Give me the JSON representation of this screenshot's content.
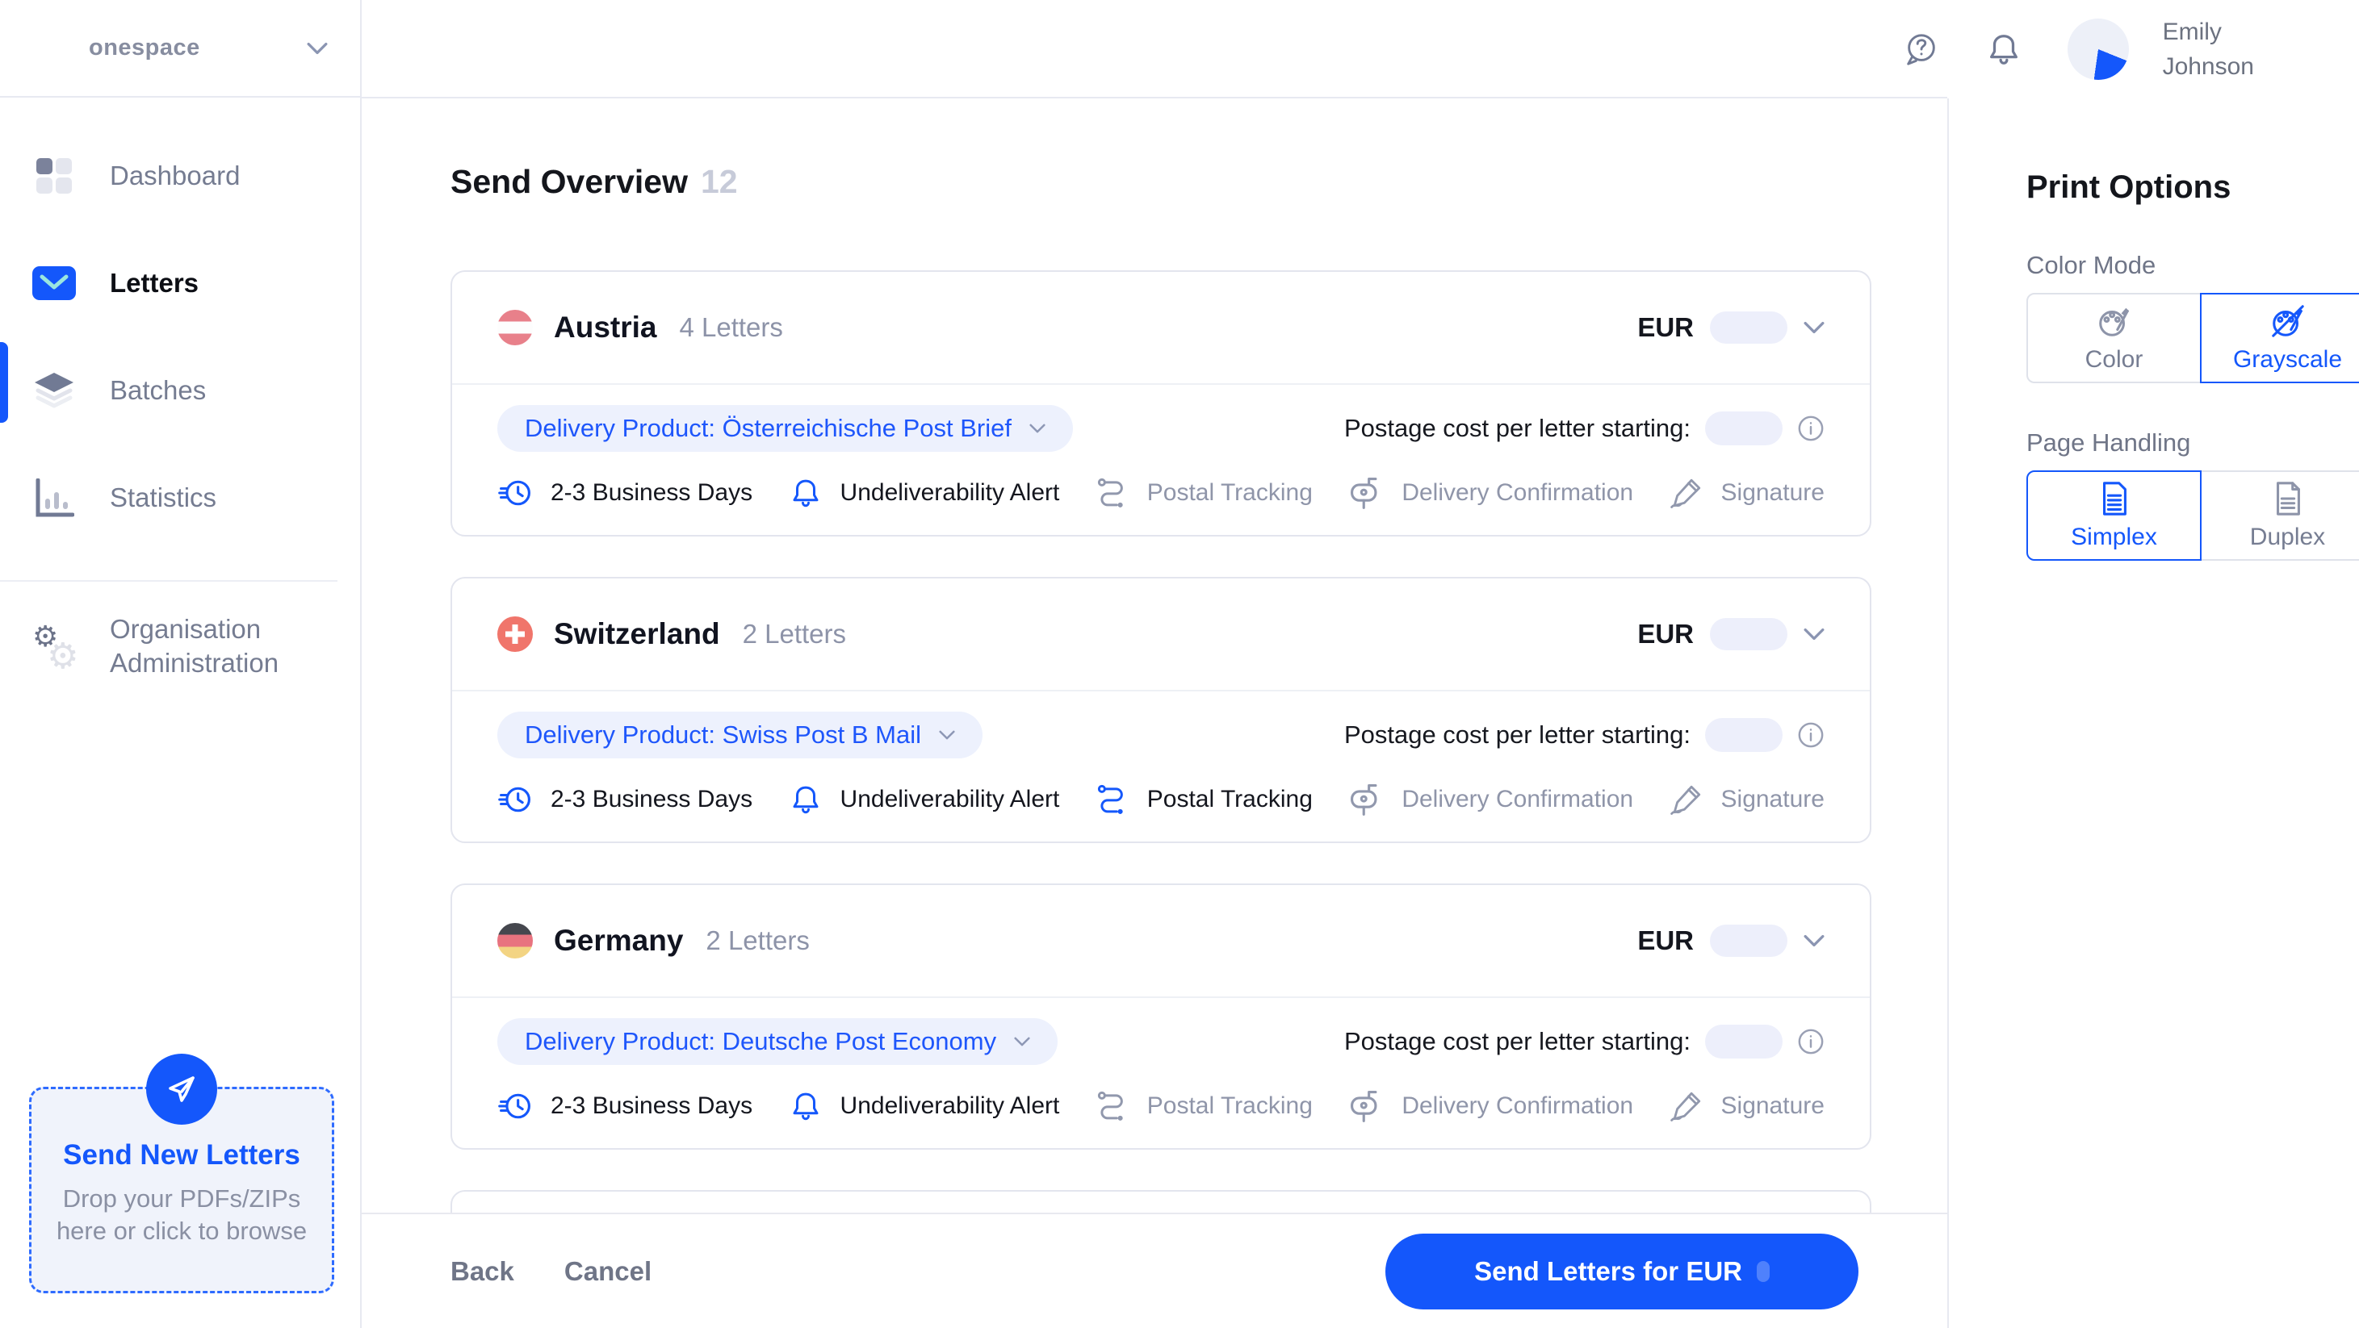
{
  "brand": {
    "name": "onespace"
  },
  "topbar": {
    "user_first": "Emily",
    "user_last": "Johnson"
  },
  "sidebar": {
    "dashboard": "Dashboard",
    "letters": "Letters",
    "batches": "Batches",
    "statistics": "Statistics",
    "org_admin_line1": "Organisation",
    "org_admin_line2": "Administration",
    "dropzone_title": "Send New Letters",
    "dropzone_sub1": "Drop your PDFs/ZIPs",
    "dropzone_sub2": "here or click to browse"
  },
  "main": {
    "title": "Send Overview",
    "count": "12",
    "cards": [
      {
        "country": "Austria",
        "letters_count": "4 Letters",
        "currency": "EUR",
        "delivery_product": "Delivery Product: Österreichische Post Brief",
        "postage_label": "Postage cost per letter starting:",
        "features": [
          {
            "label": "2-3 Business Days",
            "enabled": true
          },
          {
            "label": "Undeliverability Alert",
            "enabled": true
          },
          {
            "label": "Postal Tracking",
            "enabled": false
          },
          {
            "label": "Delivery Confirmation",
            "enabled": false
          },
          {
            "label": "Signature",
            "enabled": false
          }
        ]
      },
      {
        "country": "Switzerland",
        "letters_count": "2 Letters",
        "currency": "EUR",
        "delivery_product": "Delivery Product: Swiss Post B Mail",
        "postage_label": "Postage cost per letter starting:",
        "features": [
          {
            "label": "2-3 Business Days",
            "enabled": true
          },
          {
            "label": "Undeliverability Alert",
            "enabled": true
          },
          {
            "label": "Postal Tracking",
            "enabled": true
          },
          {
            "label": "Delivery Confirmation",
            "enabled": false
          },
          {
            "label": "Signature",
            "enabled": false
          }
        ]
      },
      {
        "country": "Germany",
        "letters_count": "2 Letters",
        "currency": "EUR",
        "delivery_product": "Delivery Product: Deutsche Post Economy",
        "postage_label": "Postage cost per letter starting:",
        "features": [
          {
            "label": "2-3 Business Days",
            "enabled": true
          },
          {
            "label": "Undeliverability Alert",
            "enabled": true
          },
          {
            "label": "Postal Tracking",
            "enabled": false
          },
          {
            "label": "Delivery Confirmation",
            "enabled": false
          },
          {
            "label": "Signature",
            "enabled": false
          }
        ]
      }
    ],
    "footer": {
      "back": "Back",
      "cancel": "Cancel",
      "send": "Send Letters for EUR"
    }
  },
  "print_options": {
    "title": "Print Options",
    "color_mode_label": "Color Mode",
    "color": "Color",
    "grayscale": "Grayscale",
    "page_handling_label": "Page Handling",
    "simplex": "Simplex",
    "duplex": "Duplex"
  },
  "colors": {
    "accent": "#1457fb",
    "accent_light_bg": "#edf1fd",
    "skeleton": "#edeffb",
    "austria_flag_red": "#e8808a",
    "swiss_flag_red": "#f0756b",
    "germany_flag_black": "#45474e",
    "germany_flag_red": "#e8737f",
    "germany_flag_gold": "#f3d483"
  }
}
